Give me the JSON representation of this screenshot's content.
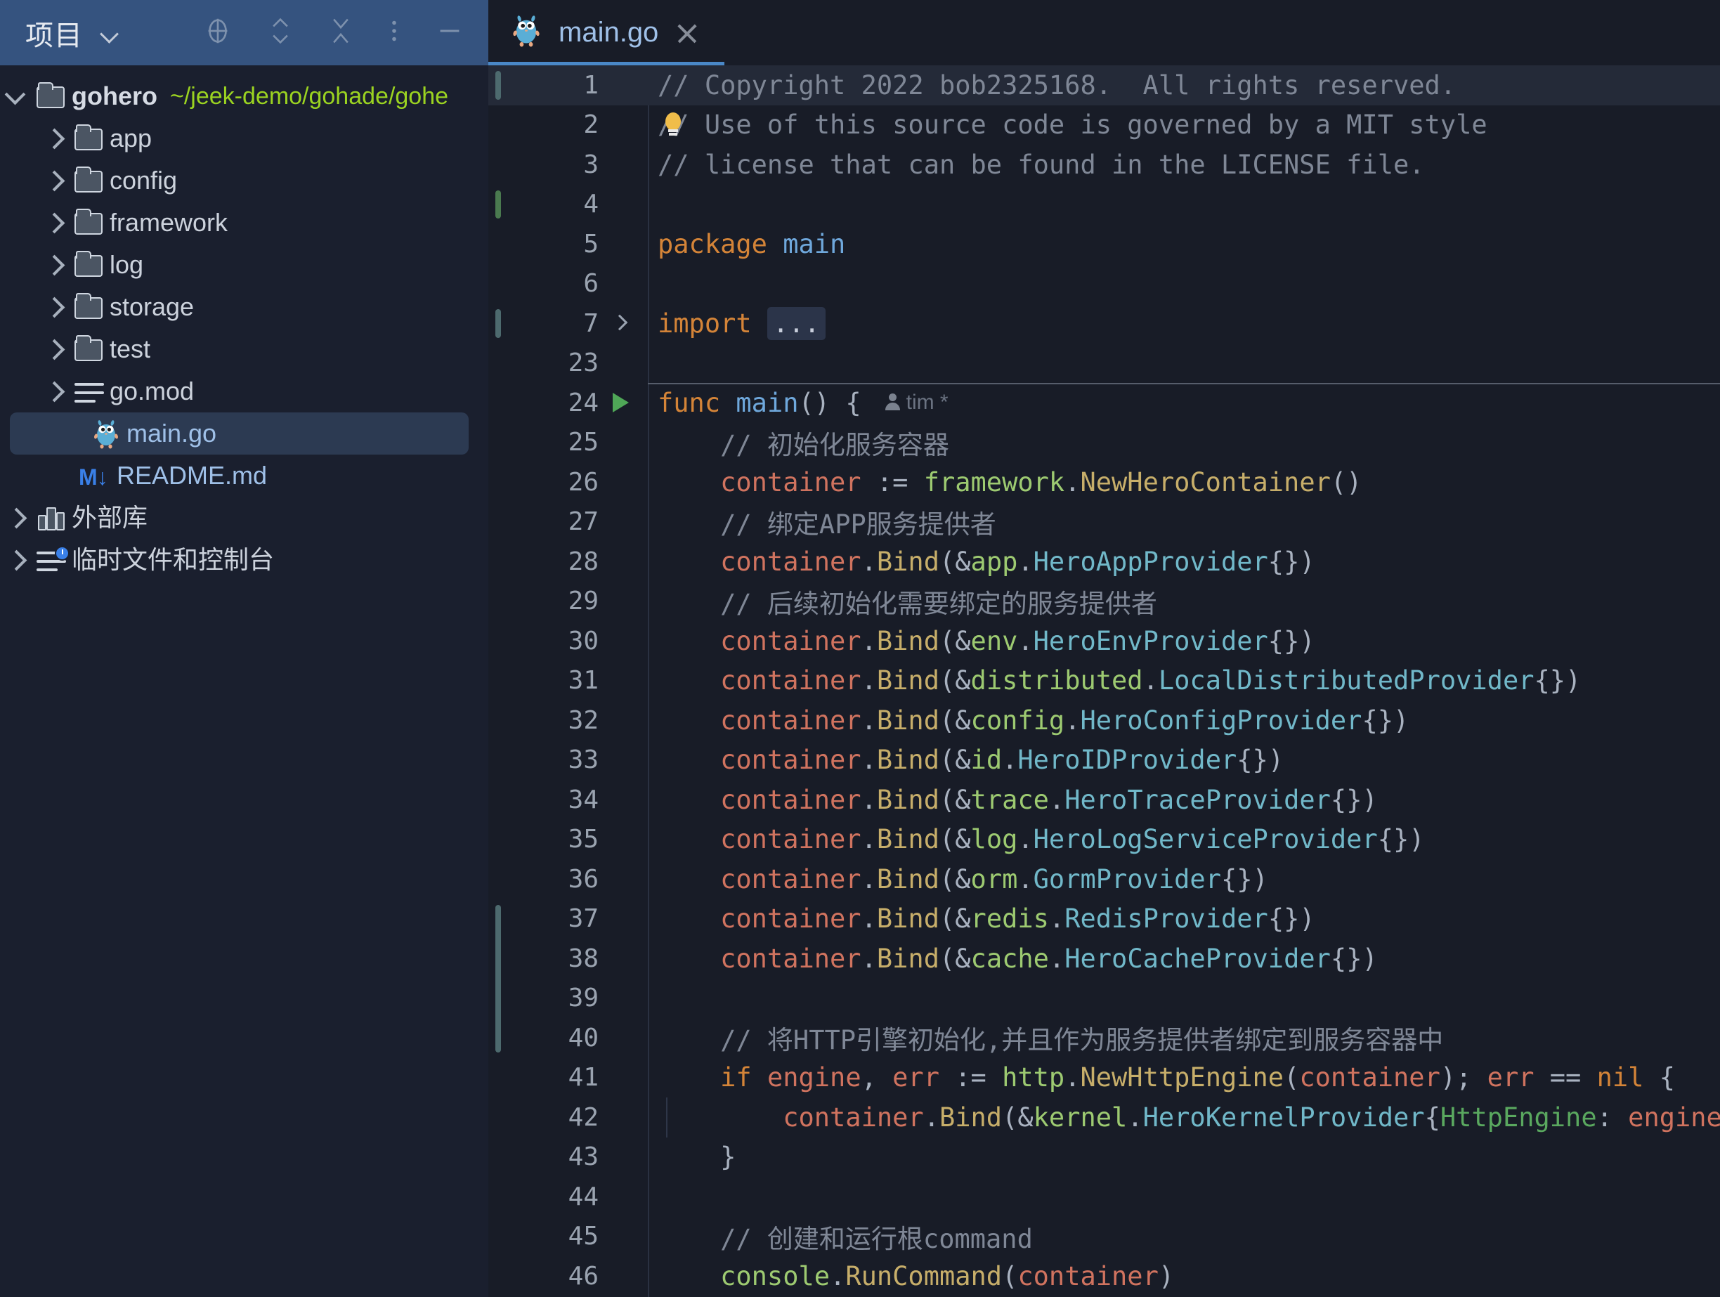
{
  "panel": {
    "title": "项目",
    "icons": [
      {
        "name": "locate-icon",
        "glyph": "target"
      },
      {
        "name": "expand-collapse-icon",
        "glyph": "chevrons"
      },
      {
        "name": "collapse-all-icon",
        "glyph": "x-collapse"
      },
      {
        "name": "more-options-icon",
        "glyph": "dots"
      },
      {
        "name": "hide-panel-icon",
        "glyph": "minus"
      }
    ]
  },
  "tree": [
    {
      "label": "gohero",
      "path": "~/jeek-demo/gohade/gohe",
      "icon": "folder-icon",
      "twisty": "open",
      "indent": 0,
      "bold": true,
      "selected": false
    },
    {
      "label": "app",
      "path": "",
      "icon": "folder-icon",
      "twisty": "closed",
      "indent": 1,
      "bold": false,
      "selected": false
    },
    {
      "label": "config",
      "path": "",
      "icon": "folder-icon",
      "twisty": "closed",
      "indent": 1,
      "bold": false,
      "selected": false
    },
    {
      "label": "framework",
      "path": "",
      "icon": "folder-icon",
      "twisty": "closed",
      "indent": 1,
      "bold": false,
      "selected": false
    },
    {
      "label": "log",
      "path": "",
      "icon": "folder-icon",
      "twisty": "closed",
      "indent": 1,
      "bold": false,
      "selected": false
    },
    {
      "label": "storage",
      "path": "",
      "icon": "folder-icon",
      "twisty": "closed",
      "indent": 1,
      "bold": false,
      "selected": false
    },
    {
      "label": "test",
      "path": "",
      "icon": "folder-icon",
      "twisty": "closed",
      "indent": 1,
      "bold": false,
      "selected": false
    },
    {
      "label": "go.mod",
      "path": "",
      "icon": "file-lines-icon",
      "twisty": "closed",
      "indent": 1,
      "bold": false,
      "selected": false
    },
    {
      "label": "main.go",
      "path": "",
      "icon": "go-gopher-icon",
      "twisty": "none",
      "indent": 2,
      "bold": false,
      "selected": true
    },
    {
      "label": "README.md",
      "path": "",
      "icon": "markdown-icon",
      "twisty": "none",
      "indent": 2,
      "bold": false,
      "selected": false
    },
    {
      "label": "外部库",
      "path": "",
      "icon": "external-libraries-icon",
      "twisty": "closed",
      "indent": 0,
      "bold": false,
      "selected": false
    },
    {
      "label": "临时文件和控制台",
      "path": "",
      "icon": "scratches-consoles-icon",
      "twisty": "closed",
      "indent": 0,
      "bold": false,
      "selected": false
    }
  ],
  "tab": {
    "label": "main.go",
    "icon": "go-gopher-icon",
    "close": "×"
  },
  "editor": {
    "author_annotation": "tim *",
    "lines": [
      {
        "no": "1",
        "current": true,
        "marker": "change",
        "code": [
          {
            "t": "// Copyright 2022 bob2325168.  All rights reserved.",
            "c": "c-com"
          }
        ]
      },
      {
        "no": "2",
        "bulb": true,
        "code": [
          {
            "t": "// Use of this source code is governed by a MIT style",
            "c": "c-com"
          }
        ]
      },
      {
        "no": "3",
        "code": [
          {
            "t": "// license that can be found in the LICENSE file.",
            "c": "c-com"
          }
        ]
      },
      {
        "no": "4",
        "marker": "change-green",
        "code": []
      },
      {
        "no": "5",
        "code": [
          {
            "t": "package ",
            "c": "c-kw"
          },
          {
            "t": "main",
            "c": "c-fn"
          }
        ]
      },
      {
        "no": "6",
        "code": []
      },
      {
        "no": "7",
        "marker": "change",
        "fold": true,
        "code": [
          {
            "t": "import ",
            "c": "c-kw"
          },
          {
            "t": "...",
            "c": "ell"
          }
        ]
      },
      {
        "no": "23",
        "code": []
      },
      {
        "no": "24",
        "run": true,
        "foldsep": true,
        "code": [
          {
            "t": "func ",
            "c": "c-kw"
          },
          {
            "t": "main",
            "c": "c-fn"
          },
          {
            "t": "() {",
            "c": "c-pun"
          }
        ],
        "author": true
      },
      {
        "no": "25",
        "code": [
          {
            "t": "    // 初始化服务容器",
            "c": "c-com"
          }
        ]
      },
      {
        "no": "26",
        "code": [
          {
            "t": "    container",
            "c": "c-var"
          },
          {
            "t": " := ",
            "c": "c-pun"
          },
          {
            "t": "framework",
            "c": "c-pkg"
          },
          {
            "t": ".",
            "c": "c-pun"
          },
          {
            "t": "NewHeroContainer",
            "c": "c-call"
          },
          {
            "t": "()",
            "c": "c-pun"
          }
        ]
      },
      {
        "no": "27",
        "code": [
          {
            "t": "    // 绑定APP服务提供者",
            "c": "c-com"
          }
        ]
      },
      {
        "no": "28",
        "code": [
          {
            "t": "    container",
            "c": "c-var"
          },
          {
            "t": ".",
            "c": "c-pun"
          },
          {
            "t": "Bind",
            "c": "c-call"
          },
          {
            "t": "(&",
            "c": "c-pun"
          },
          {
            "t": "app",
            "c": "c-pkg"
          },
          {
            "t": ".",
            "c": "c-pun"
          },
          {
            "t": "HeroAppProvider",
            "c": "c-typ"
          },
          {
            "t": "{})",
            "c": "c-pun"
          }
        ]
      },
      {
        "no": "29",
        "code": [
          {
            "t": "    // 后续初始化需要绑定的服务提供者",
            "c": "c-com"
          }
        ]
      },
      {
        "no": "30",
        "code": [
          {
            "t": "    container",
            "c": "c-var"
          },
          {
            "t": ".",
            "c": "c-pun"
          },
          {
            "t": "Bind",
            "c": "c-call"
          },
          {
            "t": "(&",
            "c": "c-pun"
          },
          {
            "t": "env",
            "c": "c-pkg"
          },
          {
            "t": ".",
            "c": "c-pun"
          },
          {
            "t": "HeroEnvProvider",
            "c": "c-typ"
          },
          {
            "t": "{})",
            "c": "c-pun"
          }
        ]
      },
      {
        "no": "31",
        "code": [
          {
            "t": "    container",
            "c": "c-var"
          },
          {
            "t": ".",
            "c": "c-pun"
          },
          {
            "t": "Bind",
            "c": "c-call"
          },
          {
            "t": "(&",
            "c": "c-pun"
          },
          {
            "t": "distributed",
            "c": "c-pkg"
          },
          {
            "t": ".",
            "c": "c-pun"
          },
          {
            "t": "LocalDistributedProvider",
            "c": "c-typ"
          },
          {
            "t": "{})",
            "c": "c-pun"
          }
        ]
      },
      {
        "no": "32",
        "code": [
          {
            "t": "    container",
            "c": "c-var"
          },
          {
            "t": ".",
            "c": "c-pun"
          },
          {
            "t": "Bind",
            "c": "c-call"
          },
          {
            "t": "(&",
            "c": "c-pun"
          },
          {
            "t": "config",
            "c": "c-pkg"
          },
          {
            "t": ".",
            "c": "c-pun"
          },
          {
            "t": "HeroConfigProvider",
            "c": "c-typ"
          },
          {
            "t": "{})",
            "c": "c-pun"
          }
        ]
      },
      {
        "no": "33",
        "code": [
          {
            "t": "    container",
            "c": "c-var"
          },
          {
            "t": ".",
            "c": "c-pun"
          },
          {
            "t": "Bind",
            "c": "c-call"
          },
          {
            "t": "(&",
            "c": "c-pun"
          },
          {
            "t": "id",
            "c": "c-pkg"
          },
          {
            "t": ".",
            "c": "c-pun"
          },
          {
            "t": "HeroIDProvider",
            "c": "c-typ"
          },
          {
            "t": "{})",
            "c": "c-pun"
          }
        ]
      },
      {
        "no": "34",
        "code": [
          {
            "t": "    container",
            "c": "c-var"
          },
          {
            "t": ".",
            "c": "c-pun"
          },
          {
            "t": "Bind",
            "c": "c-call"
          },
          {
            "t": "(&",
            "c": "c-pun"
          },
          {
            "t": "trace",
            "c": "c-pkg"
          },
          {
            "t": ".",
            "c": "c-pun"
          },
          {
            "t": "HeroTraceProvider",
            "c": "c-typ"
          },
          {
            "t": "{})",
            "c": "c-pun"
          }
        ]
      },
      {
        "no": "35",
        "code": [
          {
            "t": "    container",
            "c": "c-var"
          },
          {
            "t": ".",
            "c": "c-pun"
          },
          {
            "t": "Bind",
            "c": "c-call"
          },
          {
            "t": "(&",
            "c": "c-pun"
          },
          {
            "t": "log",
            "c": "c-pkg"
          },
          {
            "t": ".",
            "c": "c-pun"
          },
          {
            "t": "HeroLogServiceProvider",
            "c": "c-typ"
          },
          {
            "t": "{})",
            "c": "c-pun"
          }
        ]
      },
      {
        "no": "36",
        "code": [
          {
            "t": "    container",
            "c": "c-var"
          },
          {
            "t": ".",
            "c": "c-pun"
          },
          {
            "t": "Bind",
            "c": "c-call"
          },
          {
            "t": "(&",
            "c": "c-pun"
          },
          {
            "t": "orm",
            "c": "c-pkg"
          },
          {
            "t": ".",
            "c": "c-pun"
          },
          {
            "t": "GormProvider",
            "c": "c-typ"
          },
          {
            "t": "{})",
            "c": "c-pun"
          }
        ]
      },
      {
        "no": "37",
        "marker": "change",
        "code": [
          {
            "t": "    container",
            "c": "c-var"
          },
          {
            "t": ".",
            "c": "c-pun"
          },
          {
            "t": "Bind",
            "c": "c-call"
          },
          {
            "t": "(&",
            "c": "c-pun"
          },
          {
            "t": "redis",
            "c": "c-pkg"
          },
          {
            "t": ".",
            "c": "c-pun"
          },
          {
            "t": "RedisProvider",
            "c": "c-typ"
          },
          {
            "t": "{})",
            "c": "c-pun"
          }
        ]
      },
      {
        "no": "38",
        "marker": "change-mid",
        "code": [
          {
            "t": "    container",
            "c": "c-var"
          },
          {
            "t": ".",
            "c": "c-pun"
          },
          {
            "t": "Bind",
            "c": "c-call"
          },
          {
            "t": "(&",
            "c": "c-pun"
          },
          {
            "t": "cache",
            "c": "c-pkg"
          },
          {
            "t": ".",
            "c": "c-pun"
          },
          {
            "t": "HeroCacheProvider",
            "c": "c-typ"
          },
          {
            "t": "{})",
            "c": "c-pun"
          }
        ]
      },
      {
        "no": "39",
        "marker": "change-mid",
        "code": []
      },
      {
        "no": "40",
        "marker": "change-end",
        "code": [
          {
            "t": "    // 将HTTP引擎初始化,并且作为服务提供者绑定到服务容器中",
            "c": "c-com"
          }
        ]
      },
      {
        "no": "41",
        "code": [
          {
            "t": "    if ",
            "c": "c-kw"
          },
          {
            "t": "engine",
            "c": "c-var"
          },
          {
            "t": ", ",
            "c": "c-pun"
          },
          {
            "t": "err",
            "c": "c-var"
          },
          {
            "t": " := ",
            "c": "c-pun"
          },
          {
            "t": "http",
            "c": "c-pkg"
          },
          {
            "t": ".",
            "c": "c-pun"
          },
          {
            "t": "NewHttpEngine",
            "c": "c-call"
          },
          {
            "t": "(",
            "c": "c-pun"
          },
          {
            "t": "container",
            "c": "c-var"
          },
          {
            "t": "); ",
            "c": "c-pun"
          },
          {
            "t": "err",
            "c": "c-var"
          },
          {
            "t": " == ",
            "c": "c-pun"
          },
          {
            "t": "nil",
            "c": "c-kw"
          },
          {
            "t": " {",
            "c": "c-pun"
          }
        ]
      },
      {
        "no": "42",
        "guide": true,
        "code": [
          {
            "t": "        container",
            "c": "c-var"
          },
          {
            "t": ".",
            "c": "c-pun"
          },
          {
            "t": "Bind",
            "c": "c-call"
          },
          {
            "t": "(&",
            "c": "c-pun"
          },
          {
            "t": "kernel",
            "c": "c-pkg"
          },
          {
            "t": ".",
            "c": "c-pun"
          },
          {
            "t": "HeroKernelProvider",
            "c": "c-typ"
          },
          {
            "t": "{",
            "c": "c-pun"
          },
          {
            "t": "HttpEngine",
            "c": "c-fld"
          },
          {
            "t": ": ",
            "c": "c-pun"
          },
          {
            "t": "engine",
            "c": "c-var"
          },
          {
            "t": "})",
            "c": "c-pun"
          }
        ]
      },
      {
        "no": "43",
        "code": [
          {
            "t": "    }",
            "c": "c-pun"
          }
        ]
      },
      {
        "no": "44",
        "code": []
      },
      {
        "no": "45",
        "code": [
          {
            "t": "    // 创建和运行根command",
            "c": "c-com"
          }
        ]
      },
      {
        "no": "46",
        "code": [
          {
            "t": "    console",
            "c": "c-pkg"
          },
          {
            "t": ".",
            "c": "c-pun"
          },
          {
            "t": "RunCommand",
            "c": "c-call"
          },
          {
            "t": "(",
            "c": "c-pun"
          },
          {
            "t": "container",
            "c": "c-var"
          },
          {
            "t": ")",
            "c": "c-pun"
          }
        ]
      }
    ]
  },
  "colors": {
    "panel_header_blue": "#35537f",
    "panel_bg": "#1a1f2e",
    "editor_bg": "#181c27",
    "selection": "#2c3a52",
    "path_green": "#9bd321",
    "tab_active_underline": "#4a88c7",
    "keyword_orange": "#d48438",
    "variable_salmon": "#d0735f",
    "package_green": "#9dca71",
    "call_tan": "#c7ae6a",
    "type_cyan": "#71b8c9",
    "comment_gray": "#7f8796"
  }
}
